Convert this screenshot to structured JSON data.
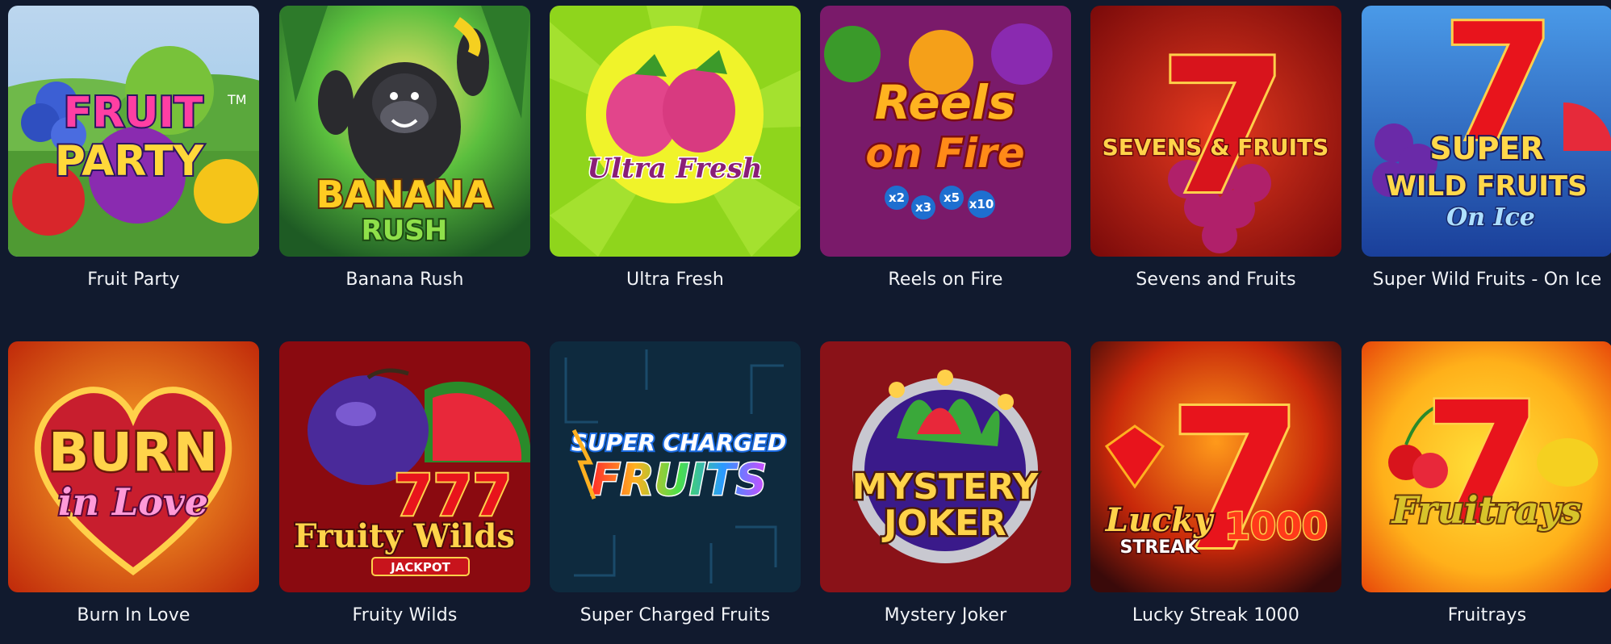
{
  "games": [
    {
      "title": "Fruit Party",
      "logo": [
        "FRUIT",
        "PARTY"
      ],
      "trademark": "TM"
    },
    {
      "title": "Banana Rush",
      "logo": [
        "BANANA",
        "RUSH"
      ]
    },
    {
      "title": "Ultra Fresh",
      "logo": [
        "Ultra Fresh"
      ]
    },
    {
      "title": "Reels on Fire",
      "logo": [
        "Reels",
        "on Fire"
      ],
      "multipliers": [
        "x2",
        "x3",
        "x5",
        "x10"
      ]
    },
    {
      "title": "Sevens and Fruits",
      "logo": [
        "SEVENS & FRUITS"
      ],
      "seven": "7"
    },
    {
      "title": "Super Wild Fruits - On Ice",
      "logo": [
        "SUPER",
        "WILD FRUITS",
        "On Ice"
      ],
      "seven": "7"
    },
    {
      "title": "Burn In Love",
      "logo": [
        "BURN",
        "in Love"
      ]
    },
    {
      "title": "Fruity Wilds",
      "logo": [
        "Fruity Wilds",
        "JACKPOT"
      ],
      "sevens": "777"
    },
    {
      "title": "Super Charged Fruits",
      "logo": [
        "SUPER CHARGED",
        "FRUITS"
      ]
    },
    {
      "title": "Mystery Joker",
      "logo": [
        "MYSTERY",
        "JOKER"
      ]
    },
    {
      "title": "Lucky Streak 1000",
      "logo": [
        "Lucky",
        "STREAK",
        "1000"
      ],
      "seven": "7"
    },
    {
      "title": "Fruitrays",
      "logo": [
        "Fruitrays"
      ],
      "seven": "7"
    }
  ]
}
